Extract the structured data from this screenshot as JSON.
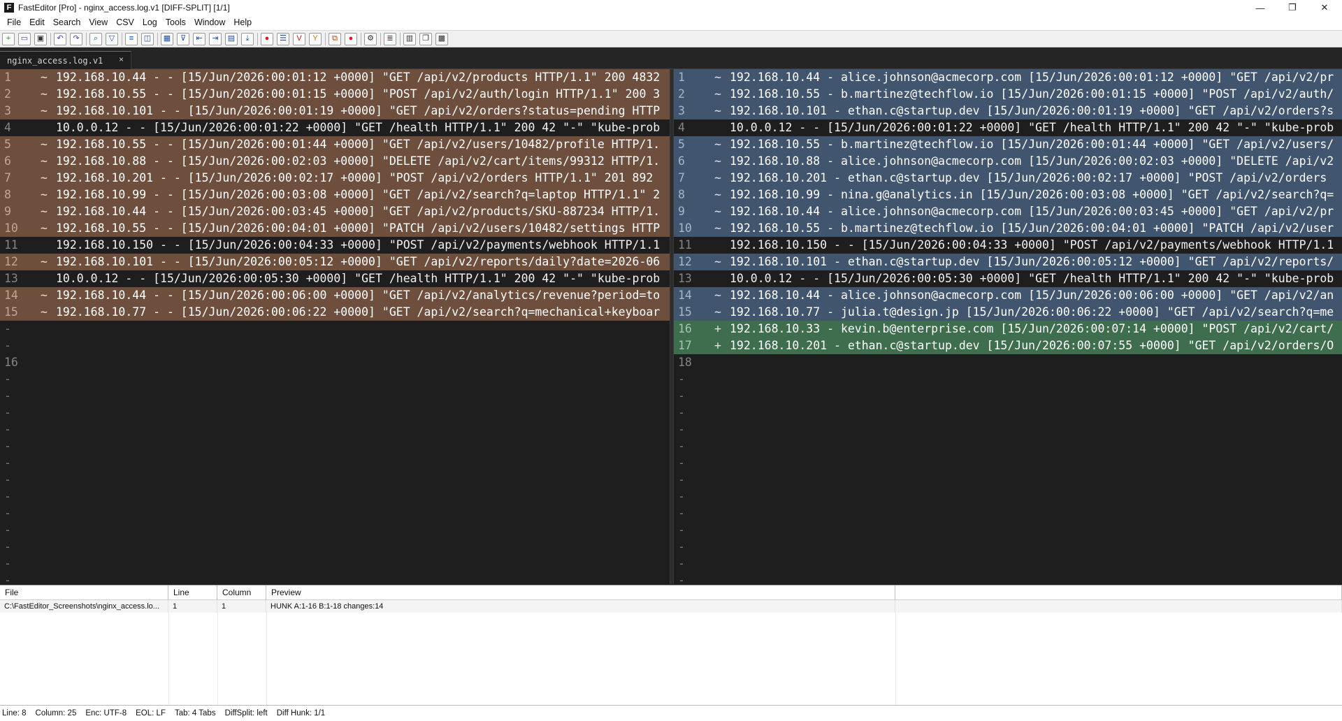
{
  "window": {
    "app_icon_letter": "F",
    "title": "FastEditor [Pro] - nginx_access.log.v1 [DIFF-SPLIT]  [1/1]",
    "controls": {
      "minimize": "—",
      "maximize": "❐",
      "close": "✕"
    }
  },
  "menu": [
    "File",
    "Edit",
    "Search",
    "View",
    "CSV",
    "Log",
    "Tools",
    "Window",
    "Help"
  ],
  "toolbar": {
    "buttons": [
      {
        "name": "new-file-icon",
        "glyph": "+",
        "color": "#2e8b2e"
      },
      {
        "name": "open-file-icon",
        "glyph": "▭",
        "color": "#1f4f9e"
      },
      {
        "name": "save-file-icon",
        "glyph": "▣",
        "color": "#333333"
      },
      {
        "sep": true
      },
      {
        "name": "undo-icon",
        "glyph": "↶",
        "color": "#5b3fb0"
      },
      {
        "name": "redo-icon",
        "glyph": "↷",
        "color": "#5b3fb0"
      },
      {
        "sep": true
      },
      {
        "name": "search-icon",
        "glyph": "⌕",
        "color": "#1f4f9e"
      },
      {
        "name": "filter-icon",
        "glyph": "▽",
        "color": "#1f4f9e"
      },
      {
        "sep": true
      },
      {
        "name": "word-wrap-icon",
        "glyph": "≡",
        "color": "#1f4f9e"
      },
      {
        "name": "split-view-icon",
        "glyph": "◫",
        "color": "#1f4f9e"
      },
      {
        "sep": true
      },
      {
        "name": "csv-grid-icon",
        "glyph": "▦",
        "color": "#1f4f9e"
      },
      {
        "name": "column-filter-icon",
        "glyph": "⊽",
        "color": "#1f4f9e"
      },
      {
        "name": "align-left-icon",
        "glyph": "⇤",
        "color": "#1f4f9e"
      },
      {
        "name": "align-right-icon",
        "glyph": "⇥",
        "color": "#1f4f9e"
      },
      {
        "name": "diff-split-icon",
        "glyph": "▤",
        "color": "#1f4f9e"
      },
      {
        "name": "jump-down-icon",
        "glyph": "⤓",
        "color": "#1f4f9e"
      },
      {
        "sep": true
      },
      {
        "name": "record-macro-icon",
        "glyph": "●",
        "color": "#d21f1f"
      },
      {
        "name": "list-icon",
        "glyph": "☰",
        "color": "#1f4f9e"
      },
      {
        "name": "mark-v-icon",
        "glyph": "V",
        "color": "#c41e1e"
      },
      {
        "name": "mark-y-icon",
        "glyph": "Y",
        "color": "#c47b00"
      },
      {
        "sep": true
      },
      {
        "name": "copy-block-icon",
        "glyph": "⧉",
        "color": "#b34400"
      },
      {
        "name": "stop-icon",
        "glyph": "●",
        "color": "#d21f1f"
      },
      {
        "sep": true
      },
      {
        "name": "settings-icon",
        "glyph": "⚙",
        "color": "#333333"
      },
      {
        "sep": true
      },
      {
        "name": "collapse-icon",
        "glyph": "≣",
        "color": "#1f4f9e"
      },
      {
        "sep": true
      },
      {
        "name": "panel-icon",
        "glyph": "▥",
        "color": "#333333"
      },
      {
        "name": "window-icon",
        "glyph": "❐",
        "color": "#333333"
      },
      {
        "name": "terminal-icon",
        "glyph": "▩",
        "color": "#333333"
      }
    ]
  },
  "tab": {
    "label": "nginx_access.log.v1",
    "close": "×"
  },
  "diff": {
    "left": [
      {
        "n": "1",
        "m": "~",
        "t": "192.168.10.44 - - [15/Jun/2026:00:01:12 +0000] \"GET /api/v2/products HTTP/1.1\" 200 4832",
        "k": "mod"
      },
      {
        "n": "2",
        "m": "~",
        "t": "192.168.10.55 - - [15/Jun/2026:00:01:15 +0000] \"POST /api/v2/auth/login HTTP/1.1\" 200 3",
        "k": "mod"
      },
      {
        "n": "3",
        "m": "~",
        "t": "192.168.10.101 - - [15/Jun/2026:00:01:19 +0000] \"GET /api/v2/orders?status=pending HTTP",
        "k": "mod"
      },
      {
        "n": "4",
        "m": "",
        "t": "10.0.0.12 - - [15/Jun/2026:00:01:22 +0000] \"GET /health HTTP/1.1\" 200 42 \"-\" \"kube-prob",
        "k": "same"
      },
      {
        "n": "5",
        "m": "~",
        "t": "192.168.10.55 - - [15/Jun/2026:00:01:44 +0000] \"GET /api/v2/users/10482/profile HTTP/1.",
        "k": "mod"
      },
      {
        "n": "6",
        "m": "~",
        "t": "192.168.10.88 - - [15/Jun/2026:00:02:03 +0000] \"DELETE /api/v2/cart/items/99312 HTTP/1.",
        "k": "mod"
      },
      {
        "n": "7",
        "m": "~",
        "t": "192.168.10.201 - - [15/Jun/2026:00:02:17 +0000] \"POST /api/v2/orders HTTP/1.1\" 201 892",
        "k": "mod"
      },
      {
        "n": "8",
        "m": "~",
        "t": "192.168.10.99 - - [15/Jun/2026:00:03:08 +0000] \"GET /api/v2/search?q=laptop HTTP/1.1\" 2",
        "k": "mod"
      },
      {
        "n": "9",
        "m": "~",
        "t": "192.168.10.44 - - [15/Jun/2026:00:03:45 +0000] \"GET /api/v2/products/SKU-887234 HTTP/1.",
        "k": "mod"
      },
      {
        "n": "10",
        "m": "~",
        "t": "192.168.10.55 - - [15/Jun/2026:00:04:01 +0000] \"PATCH /api/v2/users/10482/settings HTTP",
        "k": "mod"
      },
      {
        "n": "11",
        "m": "",
        "t": "192.168.10.150 - - [15/Jun/2026:00:04:33 +0000] \"POST /api/v2/payments/webhook HTTP/1.1",
        "k": "same"
      },
      {
        "n": "12",
        "m": "~",
        "t": "192.168.10.101 - - [15/Jun/2026:00:05:12 +0000] \"GET /api/v2/reports/daily?date=2026-06",
        "k": "mod"
      },
      {
        "n": "13",
        "m": "",
        "t": "10.0.0.12 - - [15/Jun/2026:00:05:30 +0000] \"GET /health HTTP/1.1\" 200 42 \"-\" \"kube-prob",
        "k": "same"
      },
      {
        "n": "14",
        "m": "~",
        "t": "192.168.10.44 - - [15/Jun/2026:00:06:00 +0000] \"GET /api/v2/analytics/revenue?period=to",
        "k": "mod"
      },
      {
        "n": "15",
        "m": "~",
        "t": "192.168.10.77 - - [15/Jun/2026:00:06:22 +0000] \"GET /api/v2/search?q=mechanical+keyboar",
        "k": "mod"
      },
      {
        "n": "-",
        "m": "",
        "t": "",
        "k": "filler"
      },
      {
        "n": "-",
        "m": "",
        "t": "",
        "k": "filler"
      },
      {
        "n": "16",
        "m": "",
        "t": "",
        "k": "same"
      },
      {
        "n": "-",
        "m": "",
        "t": "",
        "k": "filler"
      },
      {
        "n": "-",
        "m": "",
        "t": "",
        "k": "filler"
      },
      {
        "n": "-",
        "m": "",
        "t": "",
        "k": "filler"
      },
      {
        "n": "-",
        "m": "",
        "t": "",
        "k": "filler"
      },
      {
        "n": "-",
        "m": "",
        "t": "",
        "k": "filler"
      },
      {
        "n": "-",
        "m": "",
        "t": "",
        "k": "filler"
      },
      {
        "n": "-",
        "m": "",
        "t": "",
        "k": "filler"
      },
      {
        "n": "-",
        "m": "",
        "t": "",
        "k": "filler"
      },
      {
        "n": "-",
        "m": "",
        "t": "",
        "k": "filler"
      },
      {
        "n": "-",
        "m": "",
        "t": "",
        "k": "filler"
      },
      {
        "n": "-",
        "m": "",
        "t": "",
        "k": "filler"
      },
      {
        "n": "-",
        "m": "",
        "t": "",
        "k": "filler"
      },
      {
        "n": "-",
        "m": "",
        "t": "",
        "k": "filler"
      },
      {
        "n": "-",
        "m": "",
        "t": "",
        "k": "filler"
      }
    ],
    "right": [
      {
        "n": "1",
        "m": "~",
        "t": "192.168.10.44 - alice.johnson@acmecorp.com [15/Jun/2026:00:01:12 +0000] \"GET /api/v2/pr",
        "k": "mod"
      },
      {
        "n": "2",
        "m": "~",
        "t": "192.168.10.55 - b.martinez@techflow.io [15/Jun/2026:00:01:15 +0000] \"POST /api/v2/auth/",
        "k": "mod"
      },
      {
        "n": "3",
        "m": "~",
        "t": "192.168.10.101 - ethan.c@startup.dev [15/Jun/2026:00:01:19 +0000] \"GET /api/v2/orders?s",
        "k": "mod"
      },
      {
        "n": "4",
        "m": "",
        "t": "10.0.0.12 - - [15/Jun/2026:00:01:22 +0000] \"GET /health HTTP/1.1\" 200 42 \"-\" \"kube-prob",
        "k": "same"
      },
      {
        "n": "5",
        "m": "~",
        "t": "192.168.10.55 - b.martinez@techflow.io [15/Jun/2026:00:01:44 +0000] \"GET /api/v2/users/",
        "k": "mod"
      },
      {
        "n": "6",
        "m": "~",
        "t": "192.168.10.88 - alice.johnson@acmecorp.com [15/Jun/2026:00:02:03 +0000] \"DELETE /api/v2",
        "k": "mod"
      },
      {
        "n": "7",
        "m": "~",
        "t": "192.168.10.201 - ethan.c@startup.dev [15/Jun/2026:00:02:17 +0000] \"POST /api/v2/orders",
        "k": "mod"
      },
      {
        "n": "8",
        "m": "~",
        "t": "192.168.10.99 - nina.g@analytics.in [15/Jun/2026:00:03:08 +0000] \"GET /api/v2/search?q=",
        "k": "mod"
      },
      {
        "n": "9",
        "m": "~",
        "t": "192.168.10.44 - alice.johnson@acmecorp.com [15/Jun/2026:00:03:45 +0000] \"GET /api/v2/pr",
        "k": "mod"
      },
      {
        "n": "10",
        "m": "~",
        "t": "192.168.10.55 - b.martinez@techflow.io [15/Jun/2026:00:04:01 +0000] \"PATCH /api/v2/user",
        "k": "mod"
      },
      {
        "n": "11",
        "m": "",
        "t": "192.168.10.150 - - [15/Jun/2026:00:04:33 +0000] \"POST /api/v2/payments/webhook HTTP/1.1",
        "k": "same"
      },
      {
        "n": "12",
        "m": "~",
        "t": "192.168.10.101 - ethan.c@startup.dev [15/Jun/2026:00:05:12 +0000] \"GET /api/v2/reports/",
        "k": "mod"
      },
      {
        "n": "13",
        "m": "",
        "t": "10.0.0.12 - - [15/Jun/2026:00:05:30 +0000] \"GET /health HTTP/1.1\" 200 42 \"-\" \"kube-prob",
        "k": "same"
      },
      {
        "n": "14",
        "m": "~",
        "t": "192.168.10.44 - alice.johnson@acmecorp.com [15/Jun/2026:00:06:00 +0000] \"GET /api/v2/an",
        "k": "mod"
      },
      {
        "n": "15",
        "m": "~",
        "t": "192.168.10.77 - julia.t@design.jp [15/Jun/2026:00:06:22 +0000] \"GET /api/v2/search?q=me",
        "k": "mod"
      },
      {
        "n": "16",
        "m": "+",
        "t": "192.168.10.33 - kevin.b@enterprise.com [15/Jun/2026:00:07:14 +0000] \"POST /api/v2/cart/",
        "k": "add"
      },
      {
        "n": "17",
        "m": "+",
        "t": "192.168.10.201 - ethan.c@startup.dev [15/Jun/2026:00:07:55 +0000] \"GET /api/v2/orders/O",
        "k": "add"
      },
      {
        "n": "18",
        "m": "",
        "t": "",
        "k": "same"
      },
      {
        "n": "-",
        "m": "",
        "t": "",
        "k": "filler"
      },
      {
        "n": "-",
        "m": "",
        "t": "",
        "k": "filler"
      },
      {
        "n": "-",
        "m": "",
        "t": "",
        "k": "filler"
      },
      {
        "n": "-",
        "m": "",
        "t": "",
        "k": "filler"
      },
      {
        "n": "-",
        "m": "",
        "t": "",
        "k": "filler"
      },
      {
        "n": "-",
        "m": "",
        "t": "",
        "k": "filler"
      },
      {
        "n": "-",
        "m": "",
        "t": "",
        "k": "filler"
      },
      {
        "n": "-",
        "m": "",
        "t": "",
        "k": "filler"
      },
      {
        "n": "-",
        "m": "",
        "t": "",
        "k": "filler"
      },
      {
        "n": "-",
        "m": "",
        "t": "",
        "k": "filler"
      },
      {
        "n": "-",
        "m": "",
        "t": "",
        "k": "filler"
      },
      {
        "n": "-",
        "m": "",
        "t": "",
        "k": "filler"
      },
      {
        "n": "-",
        "m": "",
        "t": "",
        "k": "filler"
      },
      {
        "n": "-",
        "m": "",
        "t": "",
        "k": "filler"
      }
    ]
  },
  "results": {
    "columns": [
      "File",
      "Line",
      "Column",
      "Preview",
      ""
    ],
    "rows": [
      [
        "C:\\FastEditor_Screenshots\\nginx_access.lo...",
        "1",
        "1",
        "HUNK A:1-16  B:1-18  changes:14",
        ""
      ]
    ]
  },
  "status": [
    "Line: 8",
    "Column: 25",
    "Enc: UTF-8",
    "EOL: LF",
    "Tab: 4 Tabs",
    "DiffSplit: left",
    "Diff Hunk: 1/1"
  ]
}
